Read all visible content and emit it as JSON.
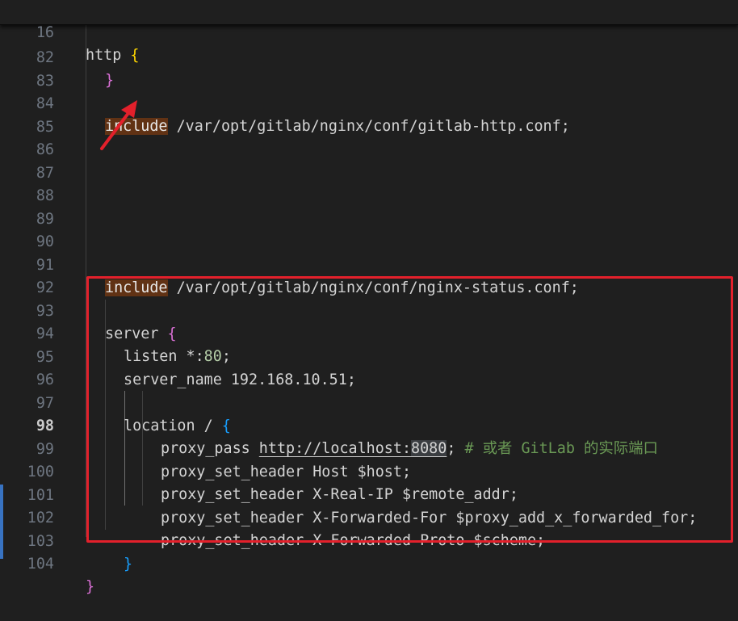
{
  "editor": {
    "sticky_line": {
      "number": "16",
      "text": "http",
      "brace": "{"
    },
    "lines": [
      {
        "number": "82",
        "brace": "}"
      },
      {
        "number": "83"
      },
      {
        "number": "84",
        "keyword": "include",
        "path": "/var/opt/gitlab/nginx/conf/gitlab-http.conf",
        "semi": ";"
      },
      {
        "number": "85"
      },
      {
        "number": "86"
      },
      {
        "number": "87"
      },
      {
        "number": "88"
      },
      {
        "number": "89"
      },
      {
        "number": "90"
      },
      {
        "number": "91",
        "keyword": "include",
        "path": "/var/opt/gitlab/nginx/conf/nginx-status.conf",
        "semi": ";"
      },
      {
        "number": "92"
      },
      {
        "number": "93",
        "text": "server",
        "brace": "{"
      },
      {
        "number": "94",
        "text": "listen *:",
        "num": "80",
        "semi": ";"
      },
      {
        "number": "95",
        "text": "server_name 192.168.10.51",
        "semi": ";"
      },
      {
        "number": "96"
      },
      {
        "number": "97",
        "text": "location / ",
        "brace": "{"
      },
      {
        "number": "98",
        "directive": "proxy_pass ",
        "url": "http://localhost:",
        "port": "8080",
        "semi": ";",
        "comment": " # 或者 GitLab 的实际端口"
      },
      {
        "number": "99",
        "text": "proxy_set_header Host $host",
        "semi": ";"
      },
      {
        "number": "100",
        "text": "proxy_set_header X-Real-IP $remote_addr",
        "semi": ";"
      },
      {
        "number": "101",
        "text": "proxy_set_header X-Forwarded-For $proxy_add_x_forwarded_for",
        "semi": ";"
      },
      {
        "number": "102",
        "text": "proxy_set_header X-Forwarded-Proto $scheme",
        "semi": ";"
      },
      {
        "number": "103",
        "brace": "}"
      },
      {
        "number": "104",
        "brace": "}"
      }
    ],
    "active_line": "98"
  },
  "colors": {
    "background": "#1f1f1f",
    "include_highlight": "#613214",
    "annotation_red": "#e3202b",
    "comment": "#6a9955",
    "number": "#b5cea8"
  },
  "annotations": {
    "arrow_icon": "red-arrow-icon",
    "box": "red-highlight-box"
  }
}
